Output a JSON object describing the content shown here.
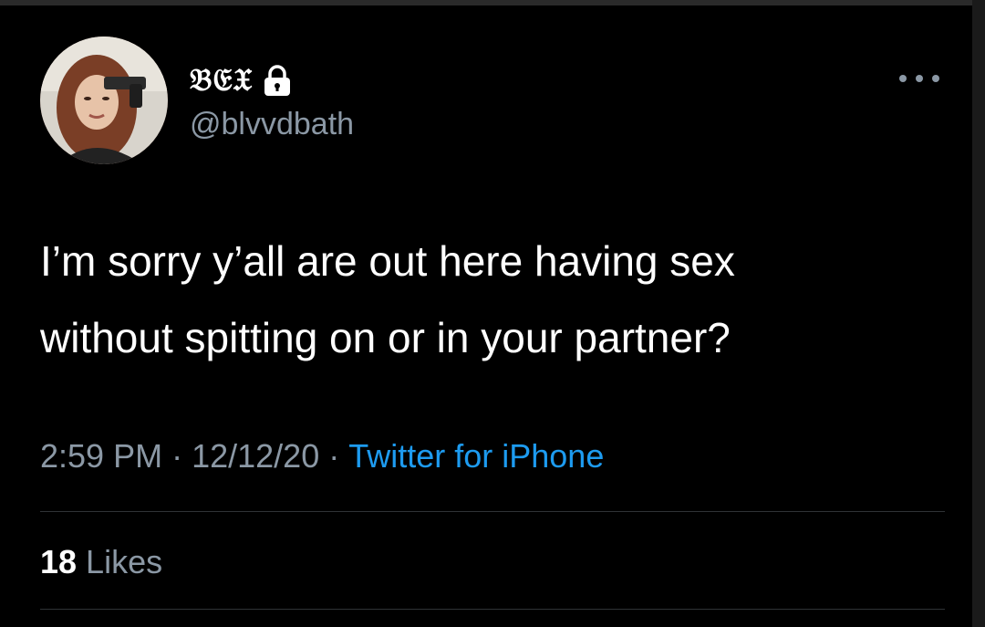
{
  "user": {
    "display_name": "𝔅𝔈𝔛",
    "handle": "@blvvdbath",
    "protected_icon": "lock-icon",
    "avatar_icon": "avatar"
  },
  "tweet": {
    "text": "I’m sorry y’all are out here having sex\nwithout spitting on or in your partner?",
    "time": "2:59 PM",
    "date": "12/12/20",
    "source": "Twitter for iPhone",
    "separator": "·"
  },
  "engagement": {
    "likes_count": "18",
    "likes_label": "Likes"
  },
  "more_icon": "more-icon",
  "colors": {
    "background": "#000000",
    "text_primary": "#ffffff",
    "text_secondary": "#8b98a5",
    "link": "#1d9bf0",
    "divider": "#2f3336"
  }
}
